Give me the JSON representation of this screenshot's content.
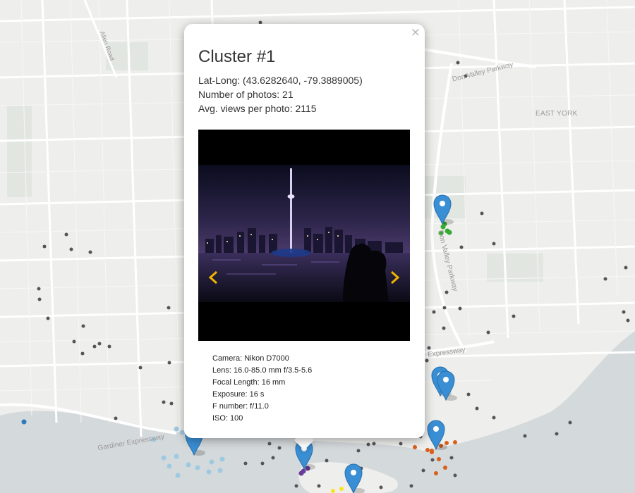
{
  "map": {
    "labels": {
      "don_valley_parkway_top": "Don Valley Parkway",
      "don_valley_parkway_side": "Don Valley Parkway",
      "east_york": "EAST YORK",
      "allen_road": "Allen Road",
      "gardiner_expressway": "Gardiner Expressway",
      "expressway": "Expressway"
    },
    "colors": {
      "land": "#eeeeec",
      "water": "#d4d9dc",
      "road": "#ffffff",
      "park": "#e2e6e0",
      "marker": "#3a8fd4",
      "point_dark": "#555555",
      "point_green": "#39a935",
      "point_lightblue": "#9ecae1",
      "point_orange": "#d95f1a",
      "point_purple": "#6a3d9a",
      "point_yellow": "#f5e61e",
      "point_blue": "#2b7bba"
    },
    "marker_icon": "map-marker-icon"
  },
  "popup": {
    "close_label": "×",
    "title": "Cluster #1",
    "lat_long": "Lat-Long: (43.6282640, -79.3889005)",
    "photo_count": "Number of photos: 21",
    "avg_views": "Avg. views per photo: 2115",
    "prev_icon": "chevron-left-icon",
    "next_icon": "chevron-right-icon",
    "exif": {
      "camera": "Camera: Nikon D7000",
      "lens": "Lens: 16.0-85.0 mm f/3.5-5.6",
      "focal_length": "Focal Length: 16 mm",
      "exposure": "Exposure: 16 s",
      "f_number": "F number: f/11.0",
      "iso": "ISO: 100"
    },
    "arrow_color": "#f0b400"
  }
}
